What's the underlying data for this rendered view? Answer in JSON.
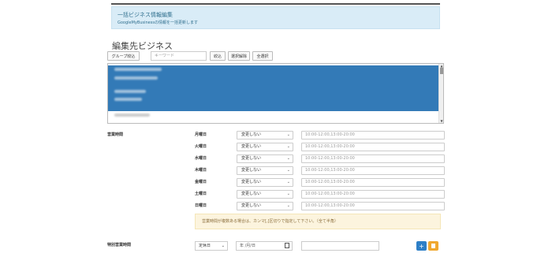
{
  "info": {
    "title": "一括ビジネス情報編集",
    "subtitle": "GoogleMyBusinessの情報を一括更新します"
  },
  "section_heading": "編集先ビジネス",
  "toolbar": {
    "group_filter": "グループ絞込",
    "keyword_placeholder": "キーワード",
    "filter": "絞込",
    "deselect": "選択解除",
    "select_all": "全選択"
  },
  "business_list": [
    {
      "label": "(blurred business name)",
      "selected": true
    },
    {
      "label": "(blurred business name)",
      "selected": false
    },
    {
      "label": "(blurred business name)",
      "selected": true
    },
    {
      "label": "(blurred business name)",
      "selected": true
    },
    {
      "label": "(blurred business name)",
      "selected": false
    }
  ],
  "hours": {
    "label": "営業時間",
    "change_option": "変更しない",
    "placeholder": "10:00-12:00,13:00-20:00",
    "days": [
      "月曜日",
      "火曜日",
      "水曜日",
      "木曜日",
      "金曜日",
      "土曜日",
      "日曜日"
    ],
    "note": "営業時間が複数ある場合は、カンマ[,]区切りで指定して下さい。（全て半角）"
  },
  "special": {
    "label": "特別営業時間",
    "type_option": "定休日",
    "date_placeholder": "年 /月/日"
  },
  "colors": {
    "accent": "#337ab7",
    "add": "#2d7fc7",
    "delete": "#f0a830"
  }
}
